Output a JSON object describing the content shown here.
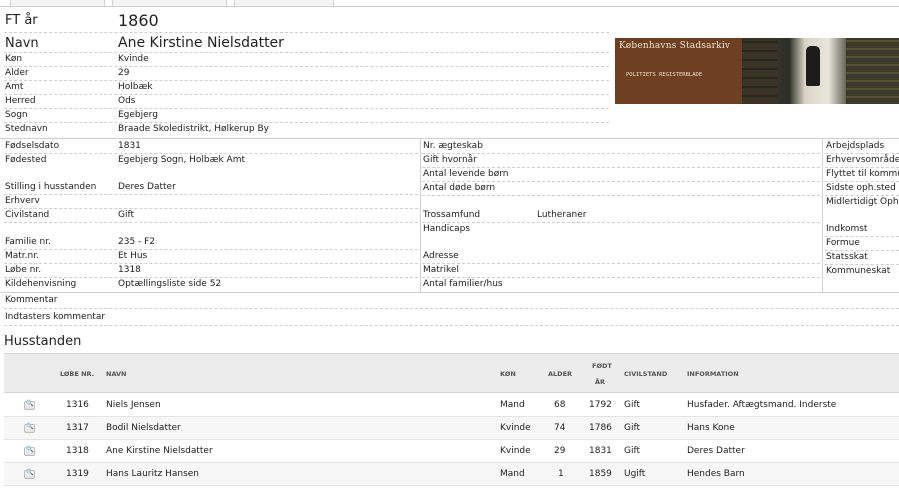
{
  "record": {
    "ft_label": "FT år",
    "ft_value": "1860",
    "navn_label": "Navn",
    "navn_value": "Ane Kirstine Nielsdatter",
    "kon_label": "Køn",
    "kon_value": "Kvinde",
    "alder_label": "Alder",
    "alder_value": "29",
    "amt_label": "Amt",
    "amt_value": "Holbæk",
    "herred_label": "Herred",
    "herred_value": "Ods",
    "sogn_label": "Sogn",
    "sogn_value": "Egebjerg",
    "stednavn_label": "Stednavn",
    "stednavn_value": "Braade Skoledistrikt, Hølkerup By"
  },
  "archive_banner": {
    "title": "Københavns Stadsarkiv",
    "subtitle": "POLITIETS REGISTERBLADE"
  },
  "col1": {
    "fodselsdato_label": "Fødselsdato",
    "fodselsdato_value": "1831",
    "fodested_label": "Fødested",
    "fodested_value": "Egebjerg Sogn, Holbæk Amt",
    "stilling_label": "Stilling i husstanden",
    "stilling_value": "Deres Datter",
    "erhverv_label": "Erhverv",
    "civilstand_label": "Civilstand",
    "civilstand_value": "Gift",
    "familie_label": "Familie nr.",
    "familie_value": "235 - F2",
    "matr_label": "Matr.nr.",
    "matr_value": "Et Hus",
    "lobe_label": "Løbe nr.",
    "lobe_value": "1318",
    "kilde_label": "Kildehenvisning",
    "kilde_value": "Optællingsliste side 52"
  },
  "col2": {
    "aegteskab_label": "Nr. ægteskab",
    "gift_label": "Gift hvornår",
    "levende_label": "Antal levende børn",
    "dode_label": "Antal døde børn",
    "tros_label": "Trossamfund",
    "tros_value": "Lutheraner",
    "handicaps_label": "Handicaps",
    "adresse_label": "Adresse",
    "matrikel_label": "Matrikel",
    "familier_label": "Antal familier/hus"
  },
  "col3": {
    "arbejdsplads_label": "Arbejdsplads",
    "erhvervsomr_label": "Erhvervsområde",
    "flyttet_label": "Flyttet til kommune",
    "sidste_label": "Sidste oph.sted",
    "midlertidigt_label": "Midlertidigt Ophold",
    "indkomst_label": "Indkomst",
    "formue_label": "Formue",
    "statsskat_label": "Statsskat",
    "kommuneskat_label": "Kommuneskat"
  },
  "comments": {
    "kommentar_label": "Kommentar",
    "indtasters_label": "Indtasters kommentar"
  },
  "household": {
    "title": "Husstanden",
    "headers": {
      "lobe": "LØBE NR.",
      "navn": "NAVN",
      "kon": "KØN",
      "alder": "ALDER",
      "fodt_1": "FØDT",
      "fodt_2": "ÅR",
      "civil": "CIVILSTAND",
      "info": "INFORMATION"
    },
    "rows": [
      {
        "lobe": "1316",
        "navn": "Niels Jensen",
        "kon": "Mand",
        "alder": "68",
        "fodt": "1792",
        "civil": "Gift",
        "info": "Husfader. Aftægtsmand. Inderste"
      },
      {
        "lobe": "1317",
        "navn": "Bodil Nielsdatter",
        "kon": "Kvinde",
        "alder": "74",
        "fodt": "1786",
        "civil": "Gift",
        "info": "Hans Kone"
      },
      {
        "lobe": "1318",
        "navn": "Ane Kirstine Nielsdatter",
        "kon": "Kvinde",
        "alder": "29",
        "fodt": "1831",
        "civil": "Gift",
        "info": "Deres Datter"
      },
      {
        "lobe": "1319",
        "navn": "Hans Lauritz Hansen",
        "kon": "Mand",
        "alder": "1",
        "fodt": "1859",
        "civil": "Ugift",
        "info": "Hendes Barn"
      }
    ]
  }
}
